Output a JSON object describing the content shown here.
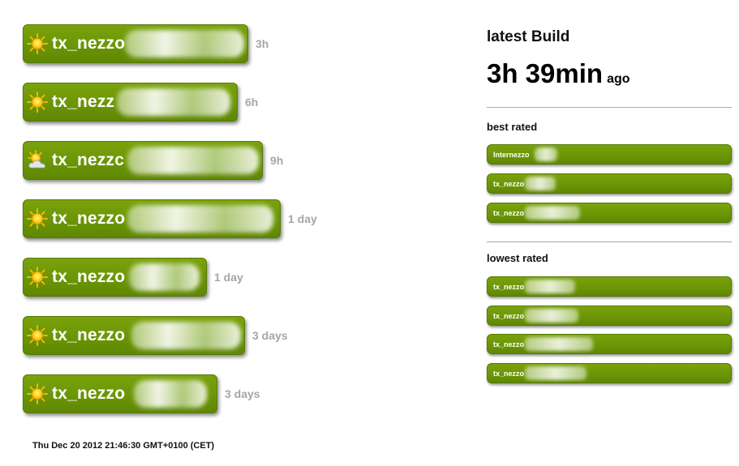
{
  "builds": [
    {
      "name": "tx_nezzo",
      "age": "3h",
      "icon": "sun-icon"
    },
    {
      "name": "tx_nezz",
      "age": "6h",
      "icon": "sun-icon"
    },
    {
      "name": "tx_nezzc",
      "age": "9h",
      "icon": "partly-cloudy-icon"
    },
    {
      "name": "tx_nezzo",
      "age": "1 day",
      "icon": "sun-icon"
    },
    {
      "name": "tx_nezzo",
      "age": "1 day",
      "icon": "sun-icon"
    },
    {
      "name": "tx_nezzo",
      "age": "3 days",
      "icon": "sun-icon"
    },
    {
      "name": "tx_nezzo",
      "age": "3 days",
      "icon": "sun-icon"
    }
  ],
  "latest": {
    "title": "latest Build",
    "time": "3h 39min",
    "suffix": "ago"
  },
  "best_rated": {
    "label": "best rated",
    "items": [
      {
        "name": "Internezzo"
      },
      {
        "name": "tx_nezzo"
      },
      {
        "name": "tx_nezzo"
      }
    ]
  },
  "lowest_rated": {
    "label": "lowest rated",
    "items": [
      {
        "name": "tx_nezzo"
      },
      {
        "name": "tx_nezzo"
      },
      {
        "name": "tx_nezzo"
      },
      {
        "name": "tx_nezzo"
      }
    ]
  },
  "footer": {
    "timestamp": "Thu Dec 20 2012 21:46:30 GMT+0100 (CET)"
  },
  "colors": {
    "bar": "#6b9505",
    "age_text": "#a6a6a6"
  }
}
